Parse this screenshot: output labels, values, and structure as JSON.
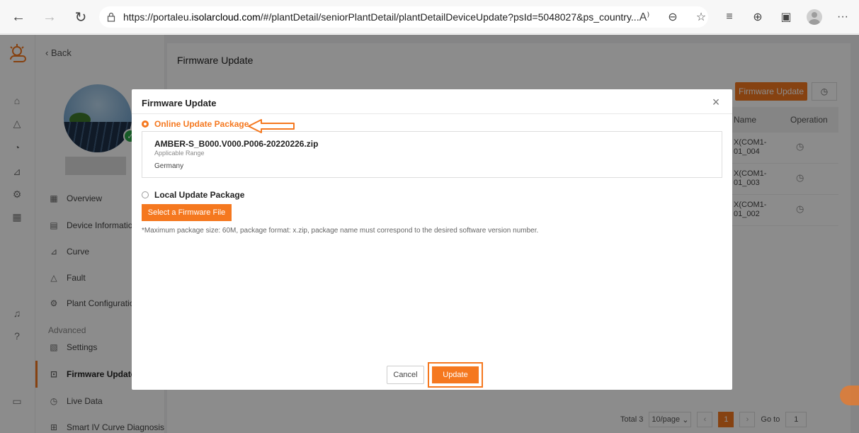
{
  "browser": {
    "url_prefix": "https://portaleu.",
    "url_domain": "isolarcloud.com",
    "url_rest": "/#/plantDetail/seniorPlantDetail/plantDetailDeviceUpdate?psId=5048027&ps_country..."
  },
  "sidebar": {
    "back_label": "Back",
    "advanced_label": "Advanced",
    "items": [
      {
        "label": "Overview"
      },
      {
        "label": "Device Information"
      },
      {
        "label": "Curve"
      },
      {
        "label": "Fault"
      },
      {
        "label": "Plant Configuration"
      },
      {
        "label": "Settings"
      },
      {
        "label": "Firmware Update"
      },
      {
        "label": "Live Data"
      },
      {
        "label": "Smart IV Curve Diagnosis"
      }
    ]
  },
  "content": {
    "title": "Firmware Update",
    "firmware_update_button": "Firmware Update",
    "table": {
      "headers": [
        "Name",
        "Operation"
      ],
      "rows": [
        {
          "name_line1": "X(COM1-",
          "name_line2": "01_004"
        },
        {
          "name_line1": "X(COM1-",
          "name_line2": "01_003"
        },
        {
          "name_line1": "X(COM1-",
          "name_line2": "01_002"
        }
      ]
    },
    "pager": {
      "total": "Total 3",
      "per_page": "10/page",
      "current_page": "1",
      "goto_label": "Go to",
      "goto_value": "1"
    }
  },
  "modal": {
    "title": "Firmware Update",
    "online_option": "Online Update Package",
    "package": {
      "file_name": "AMBER-S_B000.V000.P006-20220226.zip",
      "range_label": "Applicable Range",
      "country": "Germany"
    },
    "local_option": "Local Update Package",
    "select_file_button": "Select a Firmware File",
    "hint": "*Maximum package size: 60M, package format: x.zip, package name must correspond to the desired software version number.",
    "cancel_button": "Cancel",
    "update_button": "Update"
  },
  "colors": {
    "accent": "#f5781f",
    "success": "#2aa747"
  }
}
